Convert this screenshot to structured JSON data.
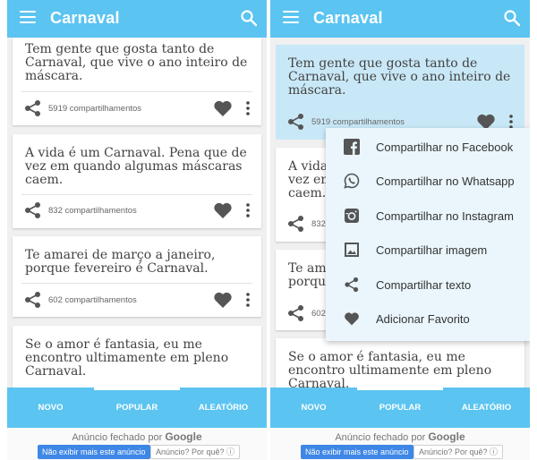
{
  "app": {
    "title": "Carnaval"
  },
  "quotes": [
    {
      "text": "Tem gente que gosta tanto de Carnaval, que vive o ano inteiro de máscara.",
      "shares": "5919 compartilhamentos"
    },
    {
      "text": "A vida é um Carnaval. Pena que de vez em quando algumas máscaras caem.",
      "shares": "832 compartilhamentos"
    },
    {
      "text": "Te amarei de março a janeiro, porque fevereiro é Carnaval.",
      "shares": "602 compartilhamentos"
    },
    {
      "text": "Se o amor é fantasia, eu me encontro ultimamente em pleno Carnaval.",
      "shares": ""
    }
  ],
  "right_quotes": [
    {
      "text": "Tem gente que gosta tanto de Carnaval, que vive o ano inteiro de máscara.",
      "shares": "5919 compartilhamentos"
    },
    {
      "text": "A vida\nvez em\ncaem.",
      "shares": "832"
    },
    {
      "text": "Te am\nporqu",
      "shares": "602"
    },
    {
      "text": "Se o amor é fantasia, eu me encontro ultimamente em pleno Carnaval.",
      "shares": ""
    }
  ],
  "tabs": [
    "NOVO",
    "POPULAR",
    "ALEATÓRIO"
  ],
  "menu": [
    {
      "label": "Compartilhar no Facebook",
      "icon": "facebook-icon"
    },
    {
      "label": "Compartilhar no Whatsapp",
      "icon": "whatsapp-icon"
    },
    {
      "label": "Compartilhar no Instagram",
      "icon": "instagram-icon"
    },
    {
      "label": "Compartilhar imagem",
      "icon": "image-icon"
    },
    {
      "label": "Compartilhar texto",
      "icon": "share-icon"
    },
    {
      "label": "Adicionar Favorito",
      "icon": "heart-icon"
    }
  ],
  "ad": {
    "closed_prefix": "Anúncio fechado por",
    "brand": "Google",
    "stop_button": "Não exibir mais este anúncio",
    "why_button": "Anúncio? Por quê? ⓘ"
  },
  "colors": {
    "primary": "#5bc4f1",
    "selected": "#c9e8f7",
    "icon": "#555555",
    "popup": "#eaf6fc"
  }
}
